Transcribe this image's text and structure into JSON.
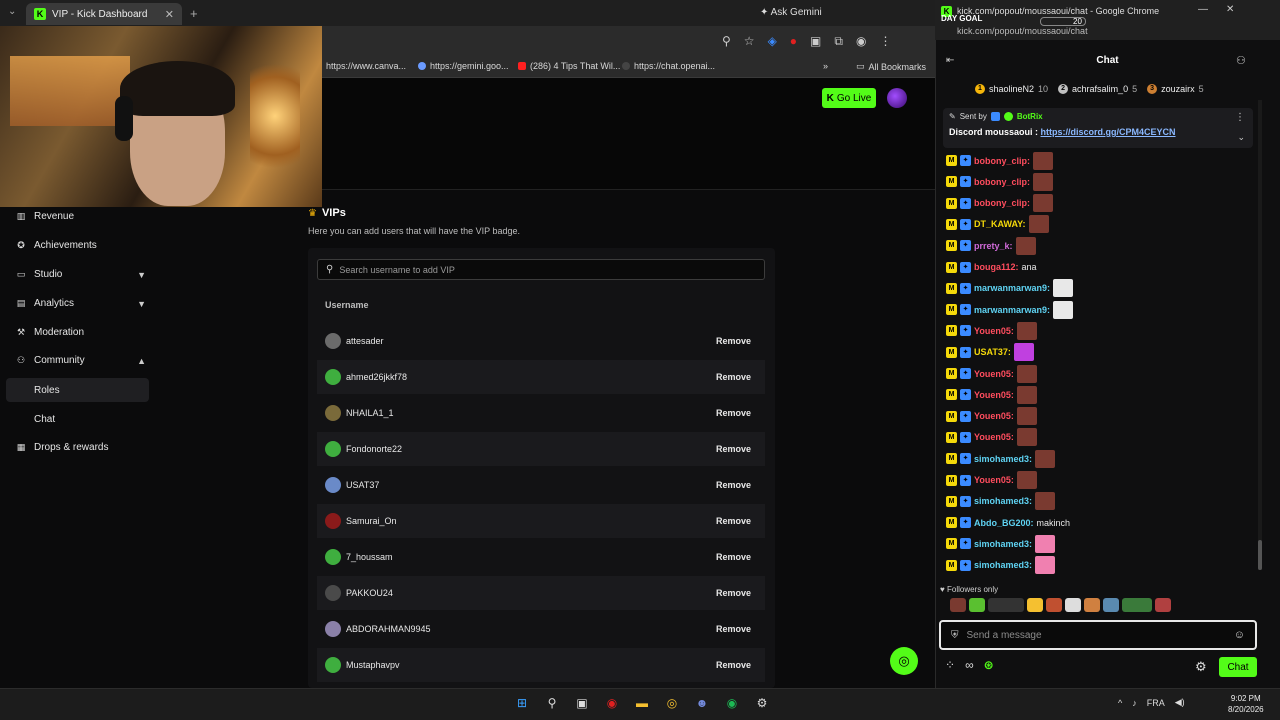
{
  "browser": {
    "tab_title": "VIP - Kick Dashboard",
    "ask_gemini": "Ask Gemini",
    "bookmarks": [
      {
        "label": "https://www.canva..."
      },
      {
        "label": "https://gemini.goo..."
      },
      {
        "label": "(286) 4 Tips That Wil..."
      },
      {
        "label": "https://chat.openai..."
      }
    ],
    "all_bookmarks": "All Bookmarks"
  },
  "header": {
    "go_live": "Go Live"
  },
  "sidebar": {
    "items": [
      {
        "label": "Revenue",
        "icon": "bar-chart-icon"
      },
      {
        "label": "Achievements",
        "icon": "trophy-icon"
      },
      {
        "label": "Studio",
        "icon": "monitor-icon"
      },
      {
        "label": "Analytics",
        "icon": "chart-icon"
      },
      {
        "label": "Moderation",
        "icon": "hammer-icon"
      },
      {
        "label": "Community",
        "icon": "users-icon"
      },
      {
        "label": "Drops & rewards",
        "icon": "gift-icon"
      }
    ],
    "sub_items": [
      "Roles",
      "Chat"
    ]
  },
  "vip": {
    "title": "VIPs",
    "description": "Here you can add users that will have the VIP badge.",
    "search_placeholder": "Search username to add VIP",
    "column_header": "Username",
    "remove_label": "Remove",
    "users": [
      {
        "name": "attesader",
        "color": "#6b6b6b"
      },
      {
        "name": "ahmed26jkkf78",
        "color": "#3fae3f"
      },
      {
        "name": "NHAILA1_1",
        "color": "#7a6a3a"
      },
      {
        "name": "Fondonorte22",
        "color": "#3fae3f"
      },
      {
        "name": "USAT37",
        "color": "#6a8ac8"
      },
      {
        "name": "Samurai_On",
        "color": "#8a1a1a"
      },
      {
        "name": "7_houssam",
        "color": "#3fae3f"
      },
      {
        "name": "PAKKOU24",
        "color": "#4a4a4a"
      },
      {
        "name": "ABDORAHMAN9945",
        "color": "#8a80a8"
      },
      {
        "name": "Mustaphavpv",
        "color": "#3fae3f"
      }
    ]
  },
  "chat_window": {
    "title": "kick.com/popout/moussaoui/chat - Google Chrome",
    "url": "kick.com/popout/moussaoui/chat",
    "day_goal": "DAY GOAL",
    "goal_count": "20",
    "header": "Chat",
    "top_gifters": [
      {
        "rank": "1",
        "name": "shaolineN2",
        "count": "10",
        "color": "#f5b50a"
      },
      {
        "rank": "2",
        "name": "achrafsalim_0",
        "count": "5",
        "color": "#c0c0c0"
      },
      {
        "rank": "3",
        "name": "zouzairx",
        "count": "5",
        "color": "#cd7f32"
      }
    ],
    "pinned": {
      "sent_by": "Sent by",
      "bot": "BotRix",
      "text": "Discord moussaoui :",
      "link": "https://discord.gg/CPM4CEYCN"
    },
    "messages": [
      {
        "user": "bobony_clip:",
        "color": "#ff4d5e",
        "text": "",
        "emote": "#7a3a30"
      },
      {
        "user": "bobony_clip:",
        "color": "#ff4d5e",
        "text": "",
        "emote": "#7a3a30"
      },
      {
        "user": "bobony_clip:",
        "color": "#ff4d5e",
        "text": "",
        "emote": "#7a3a30"
      },
      {
        "user": "DT_KAWAY:",
        "color": "#f5d90a",
        "text": "",
        "emote": "#7a3a30"
      },
      {
        "user": "prrety_k:",
        "color": "#d06ad8",
        "text": "",
        "emote": "#7a3a30"
      },
      {
        "user": "bouga112:",
        "color": "#ff4d5e",
        "text": "ana",
        "emote": ""
      },
      {
        "user": "marwanmarwan9:",
        "color": "#5fd3f3",
        "text": "",
        "emote": "#e8e8e8"
      },
      {
        "user": "marwanmarwan9:",
        "color": "#5fd3f3",
        "text": "",
        "emote": "#e8e8e8"
      },
      {
        "user": "Youen05:",
        "color": "#ff4d5e",
        "text": "",
        "emote": "#7a3a30"
      },
      {
        "user": "USAT37:",
        "color": "#f5d90a",
        "text": "",
        "emote": "#c040e0"
      },
      {
        "user": "Youen05:",
        "color": "#ff4d5e",
        "text": "",
        "emote": "#7a3a30"
      },
      {
        "user": "Youen05:",
        "color": "#ff4d5e",
        "text": "",
        "emote": "#7a3a30"
      },
      {
        "user": "Youen05:",
        "color": "#ff4d5e",
        "text": "",
        "emote": "#7a3a30"
      },
      {
        "user": "Youen05:",
        "color": "#ff4d5e",
        "text": "",
        "emote": "#7a3a30"
      },
      {
        "user": "simohamed3:",
        "color": "#5fd3f3",
        "text": "",
        "emote": "#7a3a30"
      },
      {
        "user": "Youen05:",
        "color": "#ff4d5e",
        "text": "",
        "emote": "#7a3a30"
      },
      {
        "user": "simohamed3:",
        "color": "#5fd3f3",
        "text": "",
        "emote": "#7a3a30"
      },
      {
        "user": "Abdo_BG200:",
        "color": "#5fd3f3",
        "text": "makinch",
        "emote": ""
      },
      {
        "user": "simohamed3:",
        "color": "#5fd3f3",
        "text": "",
        "emote": "#f080b0"
      },
      {
        "user": "simohamed3:",
        "color": "#5fd3f3",
        "text": "",
        "emote": "#f080b0"
      }
    ],
    "followers_only": "Followers only",
    "input_placeholder": "Send a message",
    "send_label": "Chat"
  },
  "taskbar": {
    "lang": "FRA",
    "time": "9:02 PM",
    "date": "8/20/2026"
  },
  "colors": {
    "kick_green": "#53fc18",
    "bg": "#0b0b0c"
  }
}
